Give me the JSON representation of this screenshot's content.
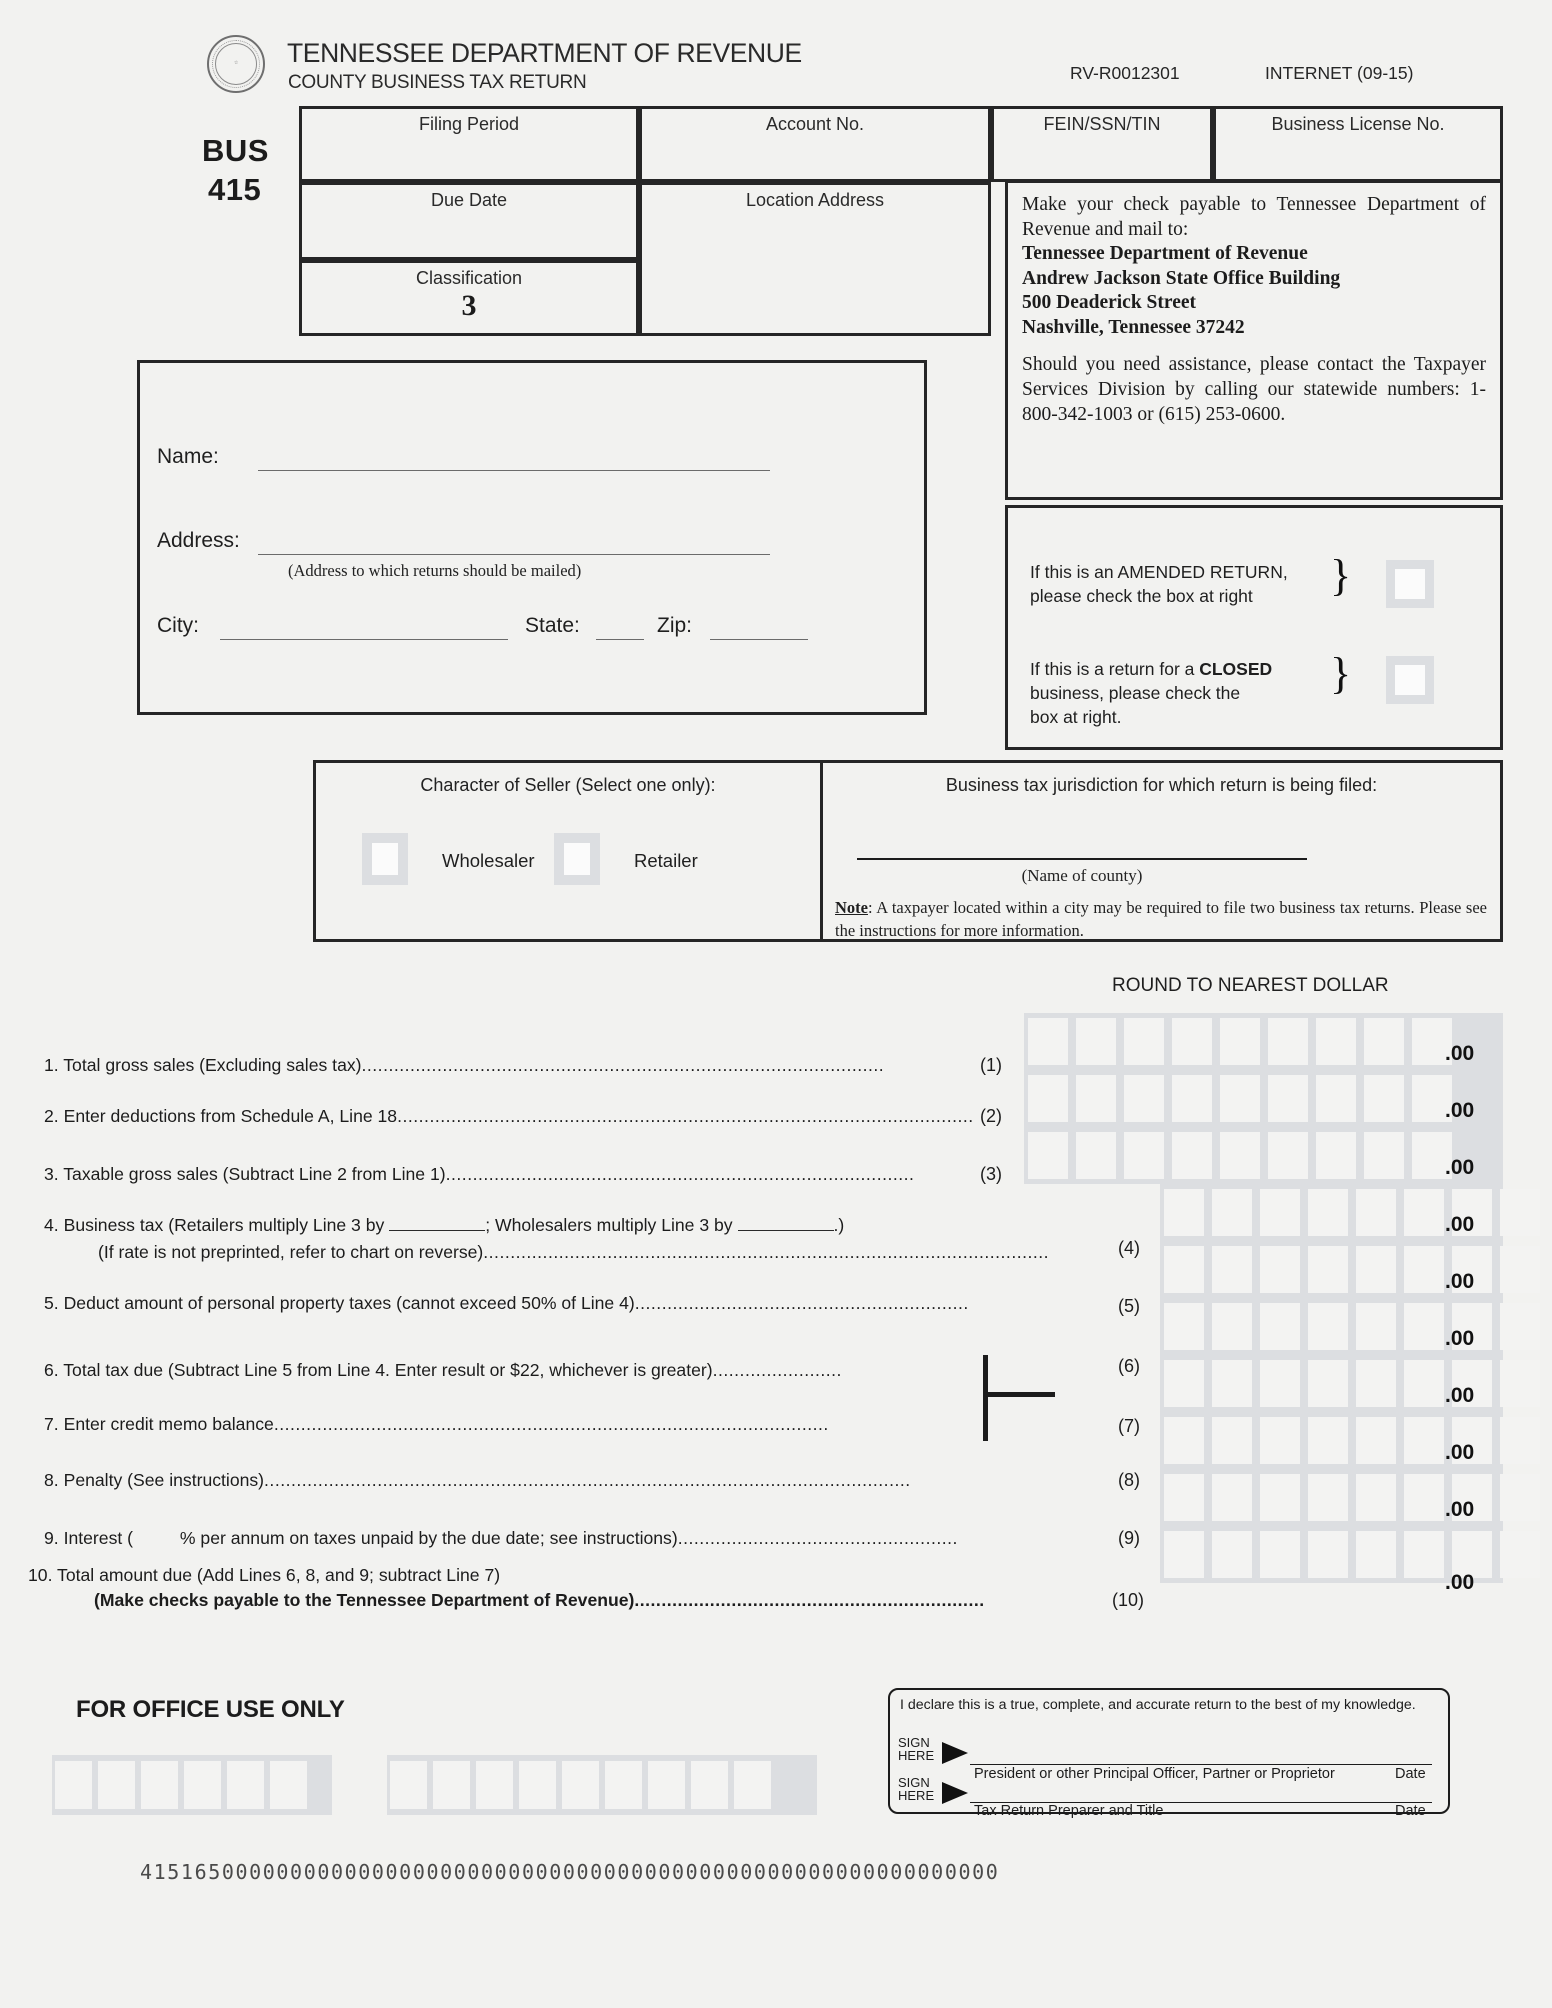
{
  "header": {
    "department": "TENNESSEE DEPARTMENT OF REVENUE",
    "form_title": "COUNTY BUSINESS TAX RETURN",
    "rv_code": "RV-R0012301",
    "internet_code": "INTERNET (09-15)",
    "form_prefix": "BUS",
    "form_number": "415",
    "seal_text": "STATE OF TENNESSEE AGRICULTURE COMMERCE 1796"
  },
  "top_fields": {
    "filing_period": "Filing Period",
    "account_no": "Account No.",
    "fein": "FEIN/SSN/TIN",
    "business_license": "Business License No.",
    "due_date": "Due Date",
    "location_address": "Location Address",
    "classification_label": "Classification",
    "classification_value": "3"
  },
  "mailing": {
    "line1": "Make your check payable to Tennessee Department of Revenue and mail to:",
    "addr1": "Tennessee Department of Revenue",
    "addr2": "Andrew Jackson State Office Building",
    "addr3": "500 Deaderick Street",
    "addr4": "Nashville, Tennessee 37242",
    "assistance": "Should you need assistance, please contact the Taxpayer Services Division by calling our statewide numbers: 1-800-342-1003 or (615) 253-0600."
  },
  "flags": {
    "amended_l1": "If this is an AMENDED RETURN,",
    "amended_l2": "please check the box at right",
    "closed_l1_a": "If this is a return for a ",
    "closed_l1_b": "CLOSED",
    "closed_l2": "business, please check the",
    "closed_l3": "box at right."
  },
  "taxpayer": {
    "name_label": "Name:",
    "address_label": "Address:",
    "address_note": "(Address to which returns should be mailed)",
    "city_label": "City:",
    "state_label": "State:",
    "zip_label": "Zip:"
  },
  "seller": {
    "title": "Character of Seller (Select one only):",
    "option_wholesaler": "Wholesaler",
    "option_retailer": "Retailer"
  },
  "jurisdiction": {
    "title": "Business tax jurisdiction for which return is being filed:",
    "county_caption": "(Name of county)",
    "note_label": "Note",
    "note_text": ": A taxpayer located within a city may be required to file two business tax returns. Please see the instructions for more information."
  },
  "amounts": {
    "round_label": "ROUND TO NEAREST DOLLAR",
    "cents_suffix": ".00",
    "wide_row_cells": 9,
    "narrow_row_cells": 8
  },
  "lines": [
    {
      "no": "1.",
      "text": "Total gross sales (Excluding sales tax)",
      "ref": "(1)"
    },
    {
      "no": "2.",
      "text": "Enter deductions from Schedule A, Line 18",
      "ref": "(2)"
    },
    {
      "no": "3.",
      "text": "Taxable gross sales (Subtract Line 2 from Line 1)",
      "ref": "(3)"
    },
    {
      "no": "4.",
      "text_a": "Business tax (Retailers multiply Line 3 by",
      "text_b": "; Wholesalers multiply Line 3 by",
      "text_c": ".)",
      "text2": "(If rate is not preprinted, refer to chart on reverse)",
      "ref": "(4)"
    },
    {
      "no": "5.",
      "text": "Deduct amount of personal property taxes (cannot exceed 50% of Line 4)",
      "ref": "(5)"
    },
    {
      "no": "6.",
      "text": "Total tax due (Subtract Line 5 from Line 4. Enter result or $22, whichever is greater)",
      "ref": "(6)"
    },
    {
      "no": "7.",
      "text": "Enter credit memo balance",
      "ref": "(7)"
    },
    {
      "no": "8.",
      "text": "Penalty (See instructions)",
      "ref": "(8)"
    },
    {
      "no": "9.",
      "text_a": "Interest (",
      "text_b": "% per annum on taxes unpaid by the due date; see instructions)",
      "ref": "(9)"
    },
    {
      "no": "10.",
      "text": "Total amount due (Add Lines 6, 8, and 9; subtract Line 7)",
      "text2": "(Make checks payable to the Tennessee Department of Revenue)",
      "ref": "(10)"
    }
  ],
  "office": {
    "title": "FOR OFFICE USE ONLY",
    "group1_cells": 6,
    "group2_cells": 9
  },
  "signature": {
    "declaration": "I declare this is a true, complete, and accurate return to the best of my knowledge.",
    "sign_here_1": "SIGN",
    "sign_here_2": "HERE",
    "caption1": "President or other  Principal Officer, Partner or Proprietor",
    "caption2": "Tax Return Preparer and Title",
    "date_label": "Date"
  },
  "ocr_line": "415165000000000000000000000000000000000000000000000000000000000"
}
